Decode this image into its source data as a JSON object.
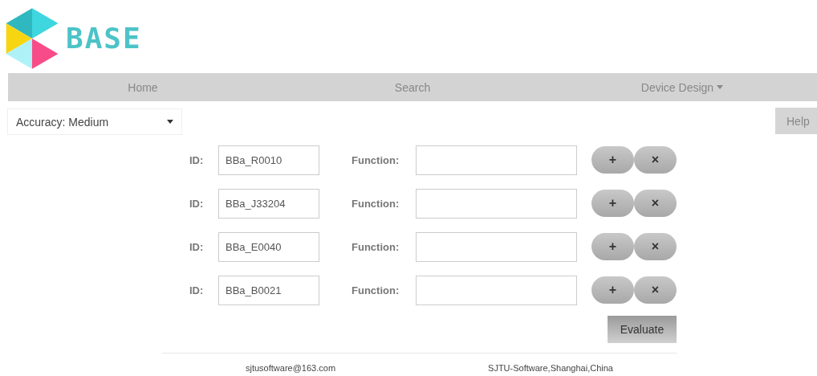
{
  "logo": {
    "text": "BASE"
  },
  "nav": [
    {
      "label": "Home",
      "dropdown": false
    },
    {
      "label": "Search",
      "dropdown": false
    },
    {
      "label": "Device Design",
      "dropdown": true
    }
  ],
  "accuracy": {
    "value": "Accuracy: Medium"
  },
  "help_button": "Help",
  "parts": [
    {
      "id_label": "ID:",
      "id": "BBa_R0010",
      "function_label": "Function:",
      "add": "+",
      "remove": "×"
    },
    {
      "id_label": "ID:",
      "id": "BBa_J33204",
      "function_label": "Function:",
      "add": "+",
      "remove": "×"
    },
    {
      "id_label": "ID:",
      "id": "BBa_E0040",
      "function_label": "Function:",
      "add": "+",
      "remove": "×"
    },
    {
      "id_label": "ID:",
      "id": "BBa_B0021",
      "function_label": "Function:",
      "add": "+",
      "remove": "×"
    }
  ],
  "evaluate_button": "Evaluate",
  "footer": {
    "email": "sjtusoftware@163.com",
    "address": "SJTU-Software,Shanghai,China"
  }
}
